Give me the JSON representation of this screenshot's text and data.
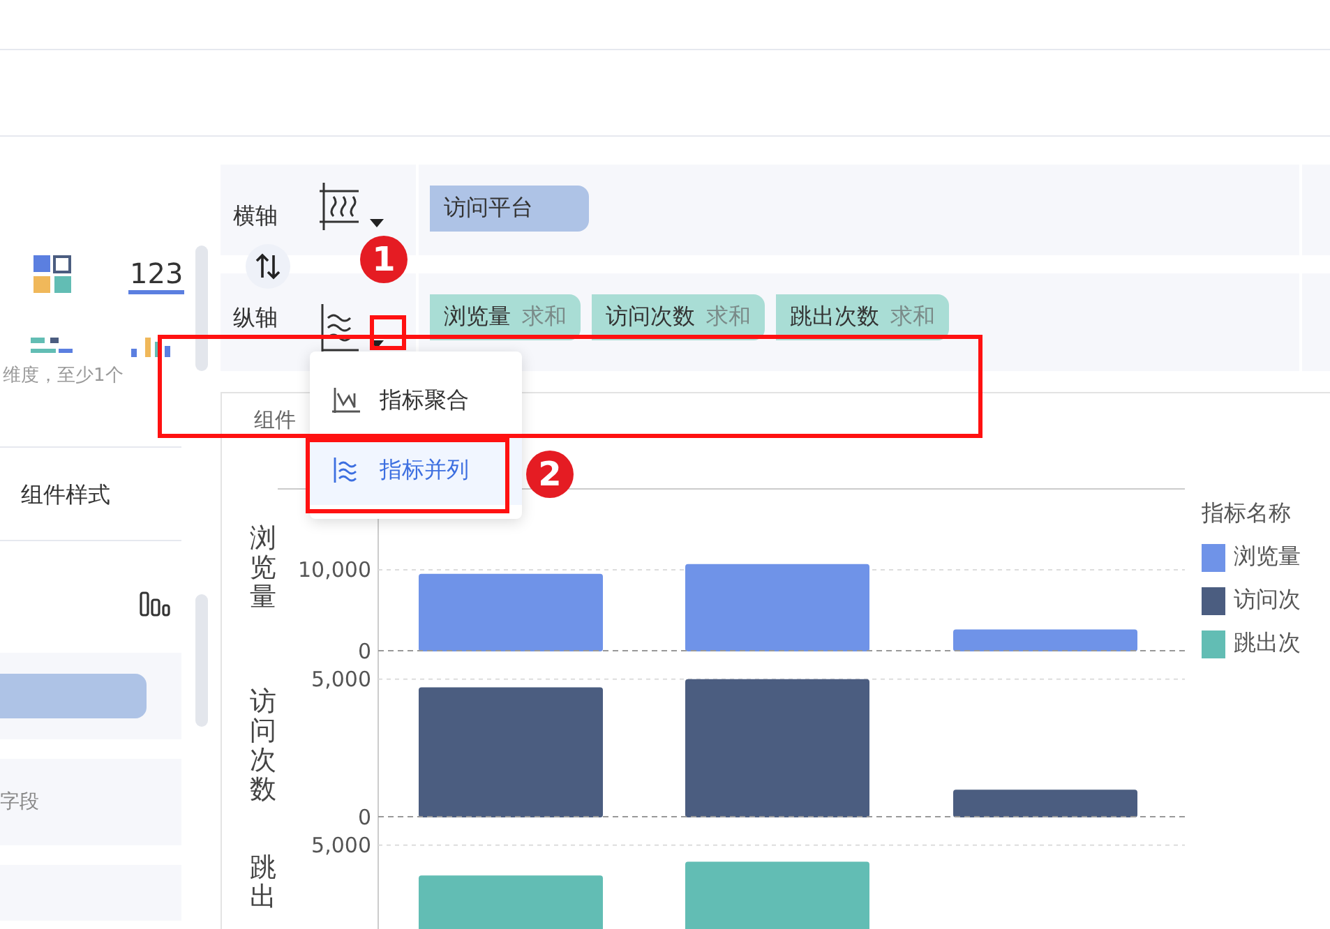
{
  "left_panel": {
    "number_label": "123",
    "hint": "维度，至少1个",
    "section_tab": "组件样式",
    "field_hint": "字段"
  },
  "axes": [
    {
      "label": "横轴",
      "kind": "horizontal",
      "chips": [
        {
          "name": "访问平台",
          "kind": "dimension"
        }
      ]
    },
    {
      "label": "纵轴",
      "kind": "vertical",
      "chips": [
        {
          "name": "浏览量",
          "aggregate": "求和",
          "kind": "measure"
        },
        {
          "name": "访问次数",
          "aggregate": "求和",
          "kind": "measure"
        },
        {
          "name": "跳出次数",
          "aggregate": "求和",
          "kind": "measure"
        }
      ]
    }
  ],
  "dropdown": {
    "items": [
      {
        "label": "指标聚合",
        "kind": "aggregate",
        "selected": false
      },
      {
        "label": "指标并列",
        "kind": "parallel",
        "selected": true
      }
    ]
  },
  "callouts": [
    "1",
    "2"
  ],
  "chart_card": {
    "title": "组件",
    "panels": [
      {
        "chart_data": {
          "type": "bar",
          "ylabel": "浏览量",
          "categories": [
            null,
            null,
            null
          ],
          "series": [
            {
              "color": "#6f93e8",
              "values": [
                9500,
                10700,
                2700
              ]
            }
          ],
          "ylim": [
            0,
            20000
          ],
          "yticks": [
            {
              "value": 10000,
              "label": "10,000"
            },
            {
              "value": 0,
              "label": "0"
            }
          ]
        }
      },
      {
        "chart_data": {
          "type": "bar",
          "ylabel": "访问次数",
          "categories": [
            null,
            null,
            null
          ],
          "series": [
            {
              "color": "#4b5d80",
              "values": [
                4700,
                5000,
                1000
              ]
            }
          ],
          "ylim": [
            0,
            6000
          ],
          "yticks": [
            {
              "value": 5000,
              "label": "5,000"
            },
            {
              "value": 0,
              "label": "0"
            }
          ]
        }
      },
      {
        "chart_data": {
          "type": "bar",
          "ylabel": "跳出",
          "categories": [
            null,
            null,
            null
          ],
          "series": [
            {
              "color": "#62bdb4",
              "values": [
                3900,
                4400,
                null
              ]
            }
          ],
          "ylim": [
            0,
            6000
          ],
          "yticks": [
            {
              "value": 5000,
              "label": "5,000"
            }
          ]
        }
      }
    ],
    "legend": {
      "title": "指标名称",
      "items": [
        {
          "label": "浏览量",
          "color": "#6f93e8"
        },
        {
          "label": "访问次",
          "color": "#4b5d80"
        },
        {
          "label": "跳出次",
          "color": "#62bdb4"
        }
      ]
    }
  }
}
